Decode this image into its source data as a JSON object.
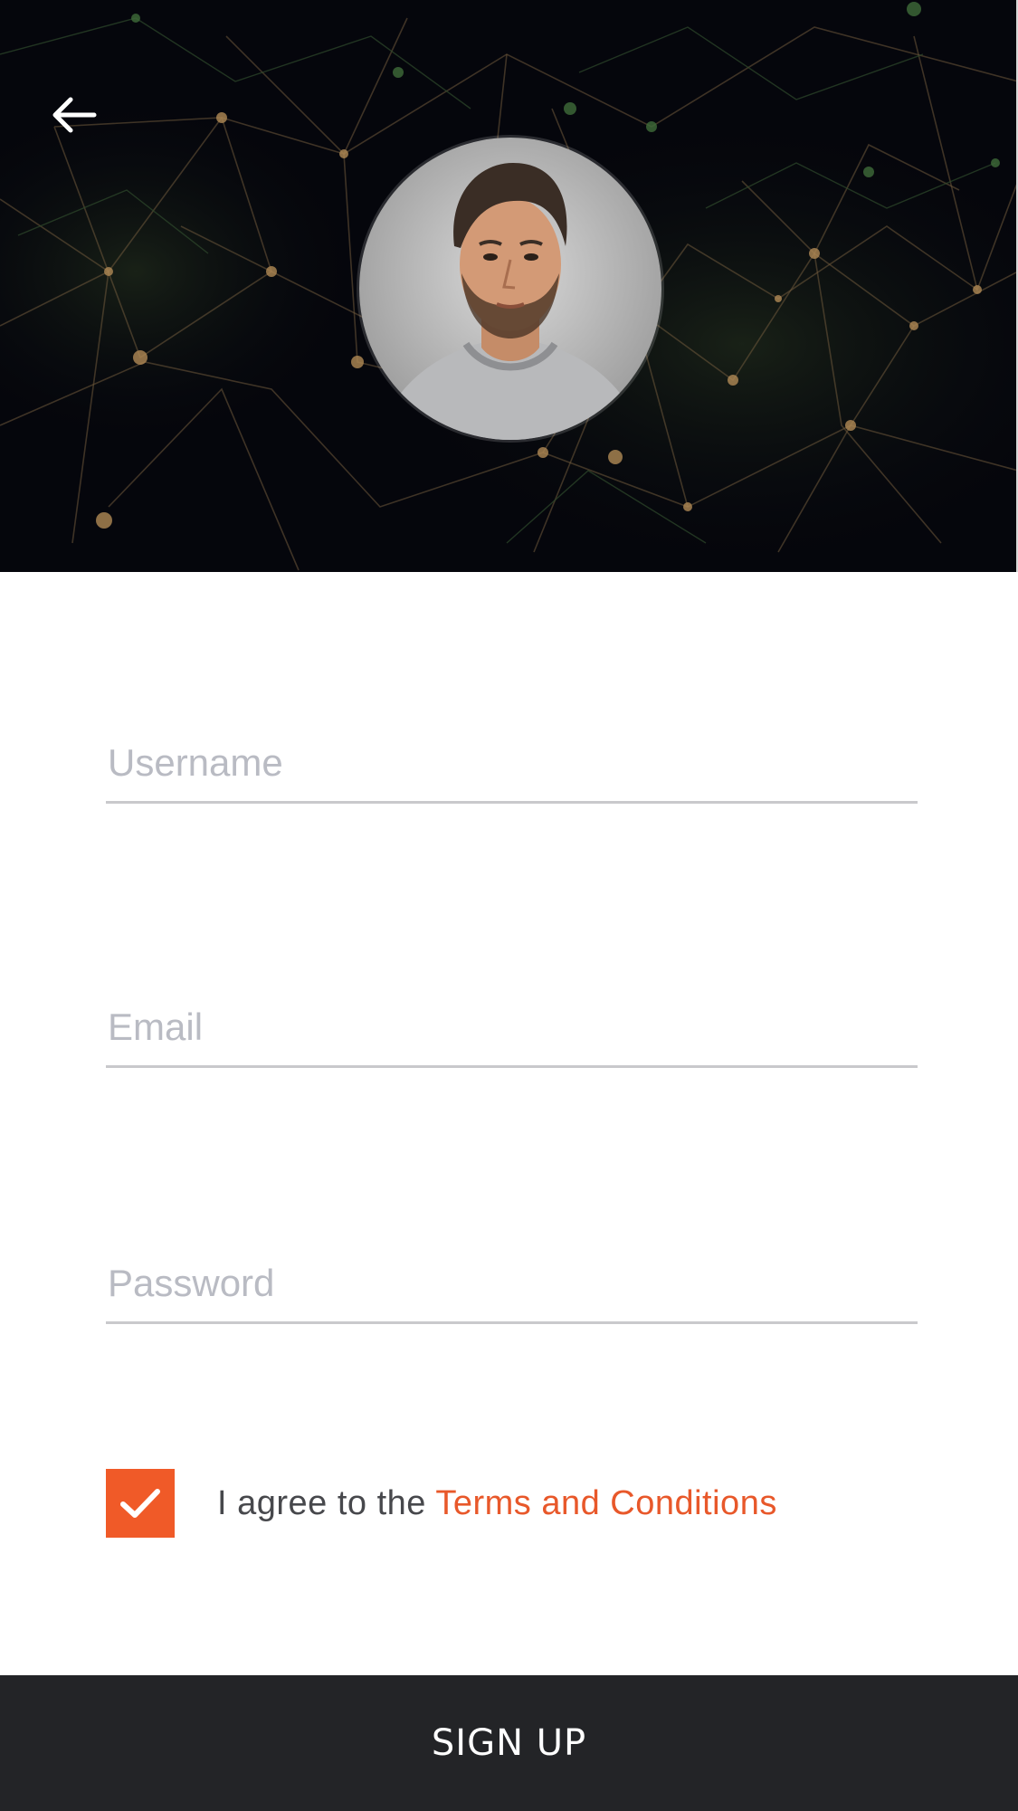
{
  "header": {
    "back_icon": "arrow-left-icon",
    "avatar_icon": "profile-photo"
  },
  "form": {
    "username": {
      "placeholder": "Username",
      "value": ""
    },
    "email": {
      "placeholder": "Email",
      "value": ""
    },
    "password": {
      "placeholder": "Password",
      "value": ""
    }
  },
  "agreement": {
    "checked": true,
    "prefix": "I agree to the",
    "link_label": "Terms and Conditions"
  },
  "signup": {
    "label": "SIGN UP"
  },
  "colors": {
    "accent": "#f05a28",
    "hero_background": "#05060c",
    "button_background": "#232427",
    "placeholder": "#b9bbc3",
    "underline": "#c9c9cc"
  }
}
